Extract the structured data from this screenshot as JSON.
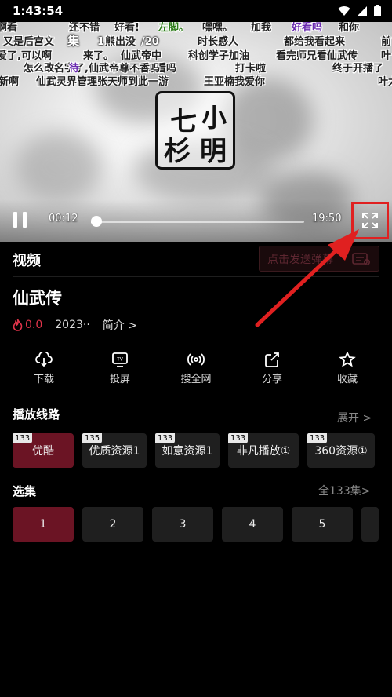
{
  "status_bar": {
    "time": "1:43:54",
    "icons": [
      "wifi-icon",
      "signal-icon",
      "battery-icon"
    ]
  },
  "player": {
    "danmaku": [
      "啊看",
      "还不错",
      "好看!",
      "左脚。",
      "嘿嘿。",
      "加我",
      "好看吗",
      "和你",
      "又是后宫文",
      "集",
      "1",
      "熊出没",
      "/20",
      "时长感人",
      "都给我看起来",
      "前",
      "爱了,可以啊",
      "来了。",
      "仙武帝中",
      "科创学子加油",
      "看完师兄看仙武传",
      "叶",
      "新啊",
      "仙武灵界管理张天师到此一游",
      "怎么改名字了,仙武帝尊不香吗",
      "待",
      "好看吗",
      "打卡啦",
      "终于开播了",
      "王亚楠我爱你",
      "叶大少我来"
    ],
    "logo_chars": [
      "七",
      "杉",
      "小",
      "明"
    ],
    "time_current": "00:12",
    "time_total": "19:50",
    "progress": 0.026
  },
  "video_heading": "视频",
  "danmaku_placeholder": "点击发送弹幕",
  "show": {
    "title": "仙武传",
    "heat": "0.0",
    "year": "2023··",
    "intro_label": "简介 >"
  },
  "actions": [
    {
      "label": "下载",
      "icon": "download-icon"
    },
    {
      "label": "投屏",
      "icon": "tv-cast-icon"
    },
    {
      "label": "搜全网",
      "icon": "broadcast-icon"
    },
    {
      "label": "分享",
      "icon": "share-icon"
    },
    {
      "label": "收藏",
      "icon": "star-icon"
    }
  ],
  "routes": {
    "heading": "播放线路",
    "expand_label": "展开 >",
    "items": [
      {
        "label": "优酷",
        "badge": "133",
        "selected": true
      },
      {
        "label": "优质资源1",
        "badge": "135",
        "selected": false
      },
      {
        "label": "如意资源1",
        "badge": "133",
        "selected": false
      },
      {
        "label": "非凡播放①",
        "badge": "133",
        "selected": false
      },
      {
        "label": "360资源①",
        "badge": "133",
        "selected": false
      }
    ]
  },
  "episodes": {
    "heading": "选集",
    "all_label": "全133集>",
    "items": [
      "1",
      "2",
      "3",
      "4",
      "5",
      ""
    ]
  },
  "colors": {
    "accent": "#6b1424",
    "heat": "#e0344a",
    "annotation": "#e02020"
  }
}
